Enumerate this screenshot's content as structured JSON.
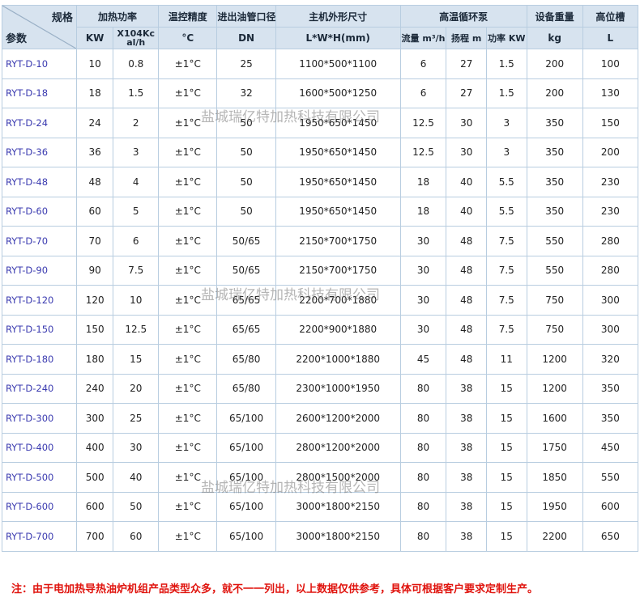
{
  "header": {
    "corner_top": "规格",
    "corner_bottom": "参数",
    "power_title": "加热功率",
    "power_kw": "KW",
    "power_kcal": "X104Kc al/h",
    "temp_title": "温控精度",
    "temp_unit": "°C",
    "pipe_title": "进出油管口径",
    "pipe_unit": "DN",
    "size_title": "主机外形尺寸",
    "size_unit": "L*W*H(mm)",
    "pump_title": "高温循环泵",
    "pump_flow": "流量 m³/h",
    "pump_head": "扬程 m",
    "pump_power": "功率 KW",
    "weight_title": "设备重量",
    "weight_unit": "kg",
    "tank_title": "高位槽",
    "tank_unit": "L"
  },
  "rows": [
    {
      "model": "RYT-D-10",
      "kw": "10",
      "kcal": "0.8",
      "temp": "±1°C",
      "dn": "25",
      "size": "1100*500*1100",
      "flow": "6",
      "head": "27",
      "pw": "1.5",
      "weight": "200",
      "tank": "100"
    },
    {
      "model": "RYT-D-18",
      "kw": "18",
      "kcal": "1.5",
      "temp": "±1°C",
      "dn": "32",
      "size": "1600*500*1250",
      "flow": "6",
      "head": "27",
      "pw": "1.5",
      "weight": "200",
      "tank": "130"
    },
    {
      "model": "RYT-D-24",
      "kw": "24",
      "kcal": "2",
      "temp": "±1°C",
      "dn": "50",
      "size": "1950*650*1450",
      "flow": "12.5",
      "head": "30",
      "pw": "3",
      "weight": "350",
      "tank": "150"
    },
    {
      "model": "RYT-D-36",
      "kw": "36",
      "kcal": "3",
      "temp": "±1°C",
      "dn": "50",
      "size": "1950*650*1450",
      "flow": "12.5",
      "head": "30",
      "pw": "3",
      "weight": "350",
      "tank": "200"
    },
    {
      "model": "RYT-D-48",
      "kw": "48",
      "kcal": "4",
      "temp": "±1°C",
      "dn": "50",
      "size": "1950*650*1450",
      "flow": "18",
      "head": "40",
      "pw": "5.5",
      "weight": "350",
      "tank": "230"
    },
    {
      "model": "RYT-D-60",
      "kw": "60",
      "kcal": "5",
      "temp": "±1°C",
      "dn": "50",
      "size": "1950*650*1450",
      "flow": "18",
      "head": "40",
      "pw": "5.5",
      "weight": "350",
      "tank": "230"
    },
    {
      "model": "RYT-D-70",
      "kw": "70",
      "kcal": "6",
      "temp": "±1°C",
      "dn": "50/65",
      "size": "2150*700*1750",
      "flow": "30",
      "head": "48",
      "pw": "7.5",
      "weight": "550",
      "tank": "280"
    },
    {
      "model": "RYT-D-90",
      "kw": "90",
      "kcal": "7.5",
      "temp": "±1°C",
      "dn": "50/65",
      "size": "2150*700*1750",
      "flow": "30",
      "head": "48",
      "pw": "7.5",
      "weight": "550",
      "tank": "280"
    },
    {
      "model": "RYT-D-120",
      "kw": "120",
      "kcal": "10",
      "temp": "±1°C",
      "dn": "65/65",
      "size": "2200*700*1880",
      "flow": "30",
      "head": "48",
      "pw": "7.5",
      "weight": "750",
      "tank": "300"
    },
    {
      "model": "RYT-D-150",
      "kw": "150",
      "kcal": "12.5",
      "temp": "±1°C",
      "dn": "65/65",
      "size": "2200*900*1880",
      "flow": "30",
      "head": "48",
      "pw": "7.5",
      "weight": "750",
      "tank": "300"
    },
    {
      "model": "RYT-D-180",
      "kw": "180",
      "kcal": "15",
      "temp": "±1°C",
      "dn": "65/80",
      "size": "2200*1000*1880",
      "flow": "45",
      "head": "48",
      "pw": "11",
      "weight": "1200",
      "tank": "320"
    },
    {
      "model": "RYT-D-240",
      "kw": "240",
      "kcal": "20",
      "temp": "±1°C",
      "dn": "65/80",
      "size": "2300*1000*1950",
      "flow": "80",
      "head": "38",
      "pw": "15",
      "weight": "1200",
      "tank": "350"
    },
    {
      "model": "RYT-D-300",
      "kw": "300",
      "kcal": "25",
      "temp": "±1°C",
      "dn": "65/100",
      "size": "2600*1200*2000",
      "flow": "80",
      "head": "38",
      "pw": "15",
      "weight": "1600",
      "tank": "350"
    },
    {
      "model": "RYT-D-400",
      "kw": "400",
      "kcal": "30",
      "temp": "±1°C",
      "dn": "65/100",
      "size": "2800*1200*2000",
      "flow": "80",
      "head": "38",
      "pw": "15",
      "weight": "1750",
      "tank": "450"
    },
    {
      "model": "RYT-D-500",
      "kw": "500",
      "kcal": "40",
      "temp": "±1°C",
      "dn": "65/100",
      "size": "2800*1500*2000",
      "flow": "80",
      "head": "38",
      "pw": "15",
      "weight": "1850",
      "tank": "550"
    },
    {
      "model": "RYT-D-600",
      "kw": "600",
      "kcal": "50",
      "temp": "±1°C",
      "dn": "65/100",
      "size": "3000*1800*2150",
      "flow": "80",
      "head": "38",
      "pw": "15",
      "weight": "1950",
      "tank": "600"
    },
    {
      "model": "RYT-D-700",
      "kw": "700",
      "kcal": "60",
      "temp": "±1°C",
      "dn": "65/100",
      "size": "3000*1800*2150",
      "flow": "80",
      "head": "38",
      "pw": "15",
      "weight": "2200",
      "tank": "650"
    }
  ],
  "watermark": "盐城瑞亿特加热科技有限公司",
  "note": "注：由于电加热导热油炉机组产品类型众多，就不一一列出，以上数据仅供参考，具体可根据客户要求定制生产。"
}
